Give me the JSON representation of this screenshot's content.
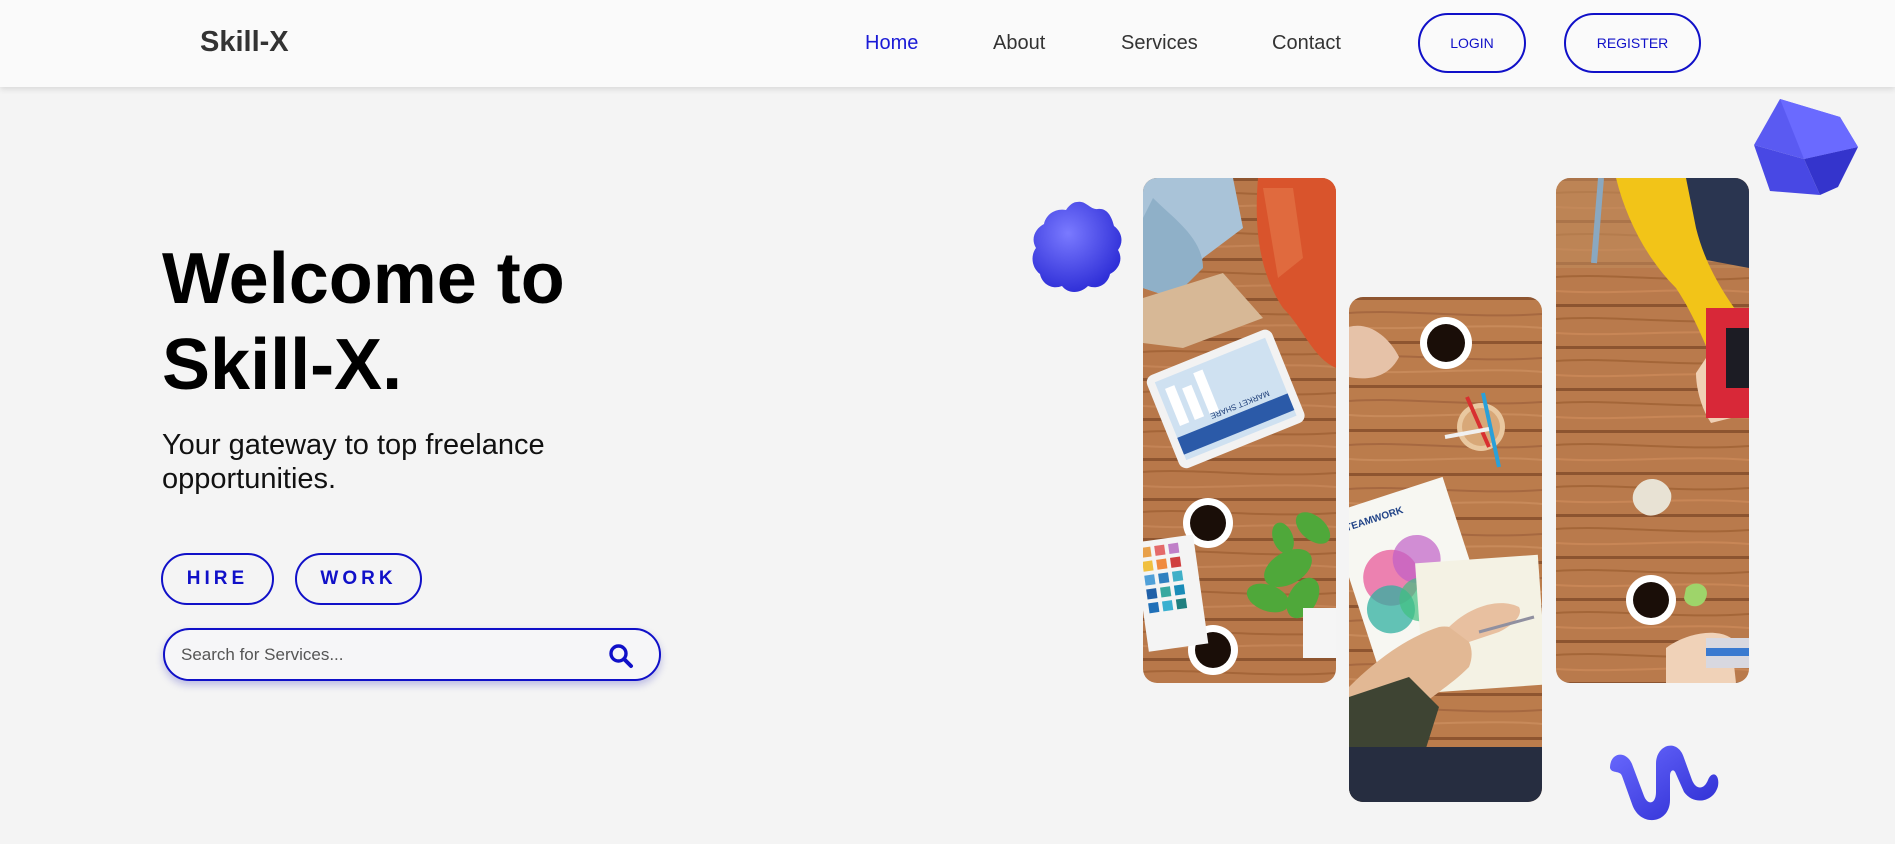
{
  "navbar": {
    "brand": "Skill-X",
    "links": [
      {
        "label": "Home",
        "active": true
      },
      {
        "label": "About",
        "active": false
      },
      {
        "label": "Services",
        "active": false
      },
      {
        "label": "Contact",
        "active": false
      }
    ],
    "login_label": "LOGIN",
    "register_label": "REGISTER"
  },
  "hero": {
    "title_line1": "Welcome to",
    "title_line2": "Skill-X.",
    "subtitle": "Your gateway to top freelance opportunities.",
    "hire_label": "HIRE",
    "work_label": "WORK",
    "search": {
      "placeholder": "Search for Services...",
      "value": "",
      "icon": "search-icon"
    }
  },
  "images": {
    "photo_1_label": "MARKET SHARE",
    "photo_2_label": "TEAMWORK"
  },
  "colors": {
    "accent": "#1010c8",
    "nav_active": "#1a1ad6",
    "background": "#f4f4f4",
    "navbar_bg": "#fafafa",
    "deco_blue": "#4848ee"
  }
}
